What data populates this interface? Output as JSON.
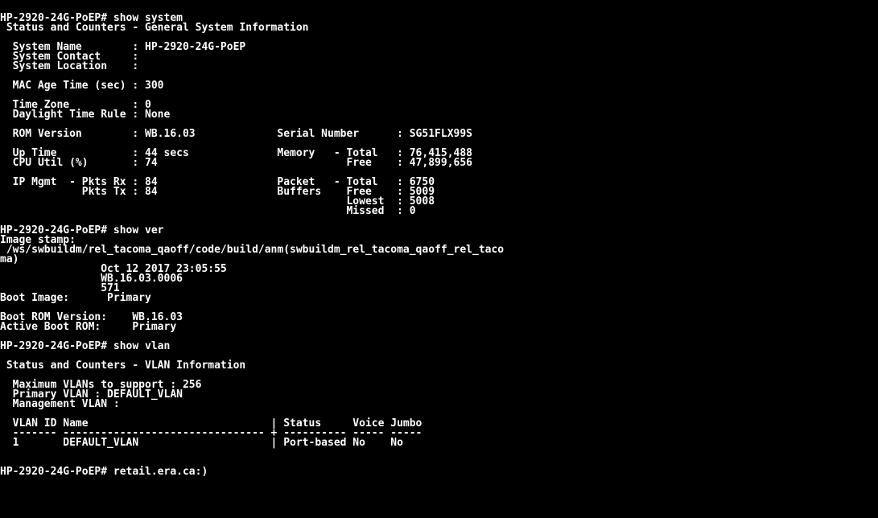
{
  "terminal": {
    "bg": "#000000",
    "fg": "#ffffff",
    "lines": [
      "HP-2920-24G-PoEP# show system",
      " Status and Counters - General System Information",
      "",
      "  System Name        : HP-2920-24G-PoEP",
      "  System Contact     :",
      "  System Location    :",
      "",
      "  MAC Age Time (sec) : 300",
      "",
      "  Time Zone          : 0",
      "  Daylight Time Rule : None",
      "",
      "  ROM Version        : WB.16.03             Serial Number      : SG51FLX99S",
      "",
      "  Up Time            : 44 secs              Memory   - Total   : 76,415,488",
      "  CPU Util (%)       : 74                              Free    : 47,899,656",
      "",
      "  IP Mgmt  - Pkts Rx : 84                   Packet   - Total   : 6750",
      "             Pkts Tx : 84                   Buffers    Free    : 5009",
      "                                                       Lowest  : 5008",
      "                                                       Missed  : 0",
      "",
      "HP-2920-24G-PoEP# show ver",
      "Image stamp:",
      " /ws/swbuildm/rel_tacoma_qaoff/code/build/anm(swbuildm_rel_tacoma_qaoff_rel_taco",
      "ma)",
      "                Oct 12 2017 23:05:55",
      "                WB.16.03.0006",
      "                571",
      "Boot Image:      Primary",
      "",
      "Boot ROM Version:    WB.16.03",
      "Active Boot ROM:     Primary",
      "",
      "HP-2920-24G-PoEP# show vlan",
      "",
      " Status and Counters - VLAN Information",
      "",
      "  Maximum VLANs to support : 256",
      "  Primary VLAN : DEFAULT_VLAN",
      "  Management VLAN :",
      "",
      "  VLAN ID Name                             | Status     Voice Jumbo",
      "  ------- -------------------------------- + ---------- ----- -----",
      "  1       DEFAULT_VLAN                     | Port-based No    No",
      "",
      "",
      "HP-2920-24G-PoEP# retail.era.ca:)"
    ]
  }
}
